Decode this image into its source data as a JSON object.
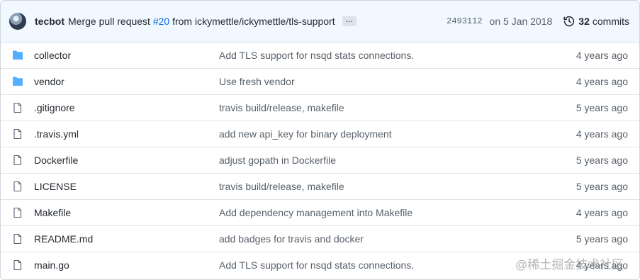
{
  "commit": {
    "author": "tecbot",
    "message_prefix": "Merge pull request ",
    "pr_ref": "#20",
    "message_suffix": " from ickymettle/ickymettle/tls-support",
    "ellipsis": "…",
    "sha": "2493112",
    "date": "on 5 Jan 2018",
    "commit_count": "32",
    "commits_label": "commits"
  },
  "files": [
    {
      "type": "folder",
      "name": "collector",
      "message": "Add TLS support for nsqd stats connections.",
      "age": "4 years ago"
    },
    {
      "type": "folder",
      "name": "vendor",
      "message": "Use fresh vendor",
      "age": "4 years ago"
    },
    {
      "type": "file",
      "name": ".gitignore",
      "message": "travis build/release, makefile",
      "age": "5 years ago"
    },
    {
      "type": "file",
      "name": ".travis.yml",
      "message": "add new api_key for binary deployment",
      "age": "4 years ago"
    },
    {
      "type": "file",
      "name": "Dockerfile",
      "message": "adjust gopath in Dockerfile",
      "age": "5 years ago"
    },
    {
      "type": "file",
      "name": "LICENSE",
      "message": "travis build/release, makefile",
      "age": "5 years ago"
    },
    {
      "type": "file",
      "name": "Makefile",
      "message": "Add dependency management into Makefile",
      "age": "4 years ago"
    },
    {
      "type": "file",
      "name": "README.md",
      "message": "add badges for travis and docker",
      "age": "5 years ago"
    },
    {
      "type": "file",
      "name": "main.go",
      "message": "Add TLS support for nsqd stats connections.",
      "age": "4 years ago"
    }
  ],
  "watermark": "@稀土掘金技术社区",
  "colors": {
    "folder": "#54aeff",
    "file_icon": "#57606a",
    "link": "#0969da",
    "header_bg": "#f1f8ff"
  }
}
